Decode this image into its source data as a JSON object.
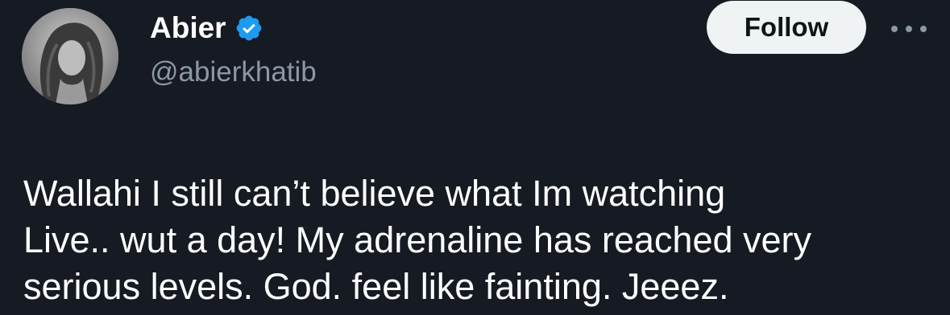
{
  "author": {
    "display_name": "Abier",
    "handle": "@abierkhatib",
    "verified": true,
    "avatar_icon": "profile-photo-icon",
    "verified_icon": "verified-badge-icon"
  },
  "actions": {
    "follow_label": "Follow",
    "more_icon": "more-options-icon"
  },
  "tweet": {
    "text": "Wallahi I still can’t believe what Im watching\nLive.. wut a day! My adrenaline has reached very\nserious levels. God. feel like fainting. Jeeez."
  },
  "colors": {
    "background": "#161a23",
    "verified_blue": "#1d9bf0",
    "handle_gray": "#8b98a5",
    "follow_bg": "#eff3f4"
  }
}
